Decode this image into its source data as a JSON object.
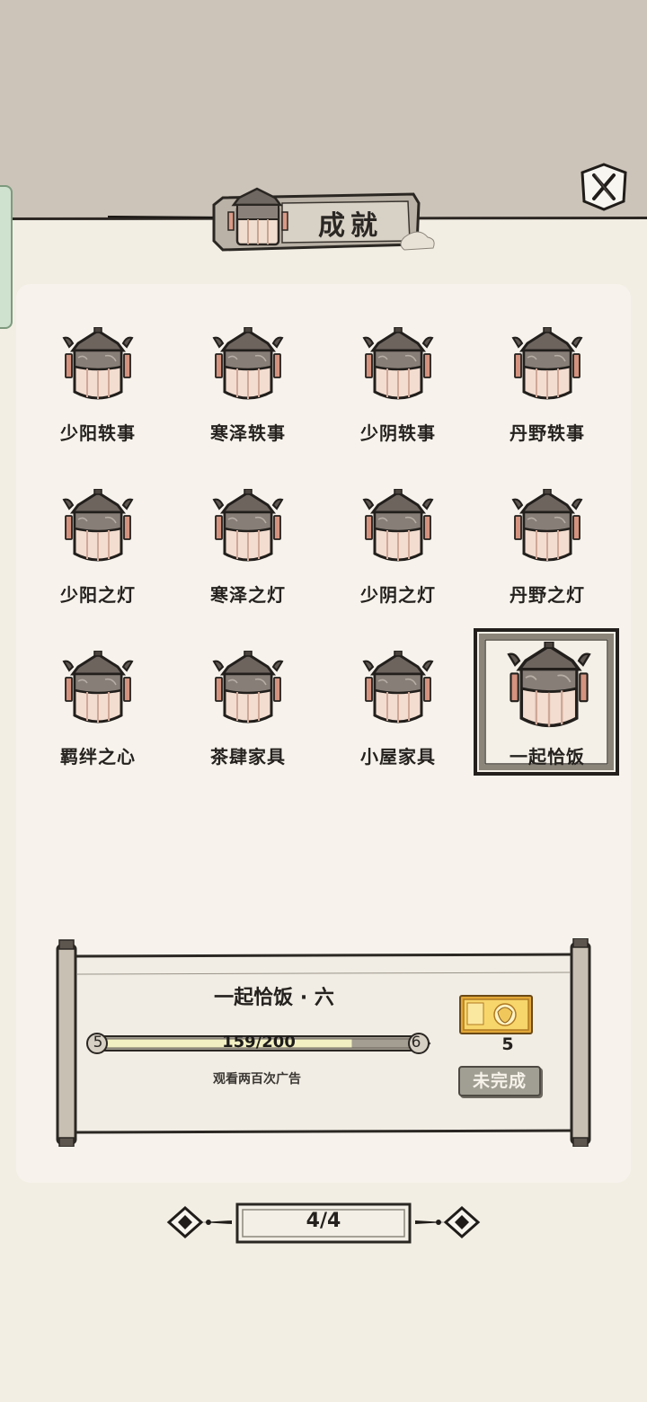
{
  "header": {
    "title": "成就"
  },
  "achievements": [
    {
      "label": "少阳轶事",
      "selected": false
    },
    {
      "label": "寒泽轶事",
      "selected": false
    },
    {
      "label": "少阴轶事",
      "selected": false
    },
    {
      "label": "丹野轶事",
      "selected": false
    },
    {
      "label": "少阳之灯",
      "selected": false
    },
    {
      "label": "寒泽之灯",
      "selected": false
    },
    {
      "label": "少阴之灯",
      "selected": false
    },
    {
      "label": "丹野之灯",
      "selected": false
    },
    {
      "label": "羁绊之心",
      "selected": false
    },
    {
      "label": "茶肆家具",
      "selected": false
    },
    {
      "label": "小屋家具",
      "selected": false
    },
    {
      "label": "一起恰饭",
      "selected": true
    }
  ],
  "detail": {
    "title": "一起恰饭 · 六",
    "progress_text": "159/200",
    "progress_current": 159,
    "progress_total": 200,
    "level_from": "5",
    "level_to": "6",
    "description": "观看两百次广告",
    "reward_count": "5",
    "status_label": "未完成"
  },
  "pager": {
    "text": "4/4"
  },
  "icons": {
    "close": "close-x-icon",
    "achievement": "lantern-icon",
    "reward": "golden-ticket-icon",
    "prev": "ornate-arrow-left-icon",
    "next": "ornate-arrow-right-icon"
  }
}
